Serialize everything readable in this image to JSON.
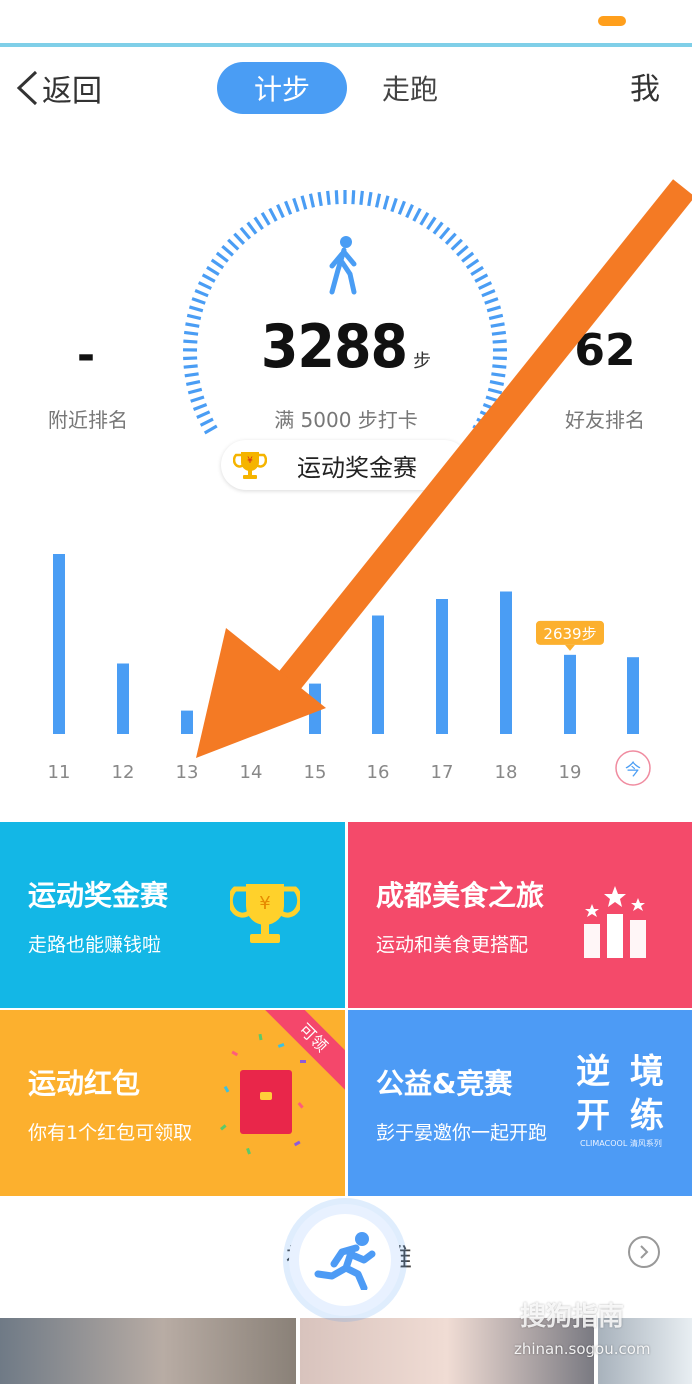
{
  "header": {
    "back_label": "返回",
    "tabs": [
      {
        "label": "计步",
        "active": true
      },
      {
        "label": "走跑",
        "active": false
      }
    ],
    "me_label": "我"
  },
  "stats": {
    "steps": "3288",
    "steps_unit": "步",
    "goal_text": "满 5000 步打卡",
    "nearby_rank_value": "-",
    "nearby_rank_label": "附近排名",
    "friend_rank_value": "62",
    "friend_rank_label": "好友排名",
    "prize_label": "运动奖金赛"
  },
  "chart_data": {
    "type": "bar",
    "categories": [
      "11",
      "12",
      "13",
      "14",
      "15",
      "16",
      "17",
      "18",
      "19",
      "今"
    ],
    "values": [
      6000,
      2350,
      780,
      0,
      1680,
      3950,
      4500,
      4750,
      2639,
      2560
    ],
    "highlight_label": "2639步",
    "highlight_index": 8,
    "ylim": [
      0,
      6200
    ],
    "bar_color": "#4a9df4"
  },
  "cards": [
    {
      "title": "运动奖金赛",
      "subtitle": "走路也能赚钱啦",
      "color": "#13b7e6",
      "icon": "trophy-icon"
    },
    {
      "title": "成都美食之旅",
      "subtitle": "运动和美食更搭配",
      "color": "#f44a6a",
      "icon": "podium-stars-icon"
    },
    {
      "title": "运动红包",
      "subtitle": "你有1个红包可领取",
      "color": "#fcb02e",
      "icon": "red-envelope-icon",
      "ribbon": "可领"
    },
    {
      "title": "公益&竞赛",
      "subtitle": "彭于晏邀你一起开跑",
      "color": "#4d9bf5",
      "slogan_line1": "逆 境",
      "slogan_line2": "开 练",
      "slogan_small": "CLIMACOOL 清风系列"
    }
  ],
  "bottom": {
    "title_left": "祖",
    "title_right": "推",
    "watermark": "搜狗指南",
    "watermark_url": "zhinan.sogou.com"
  }
}
